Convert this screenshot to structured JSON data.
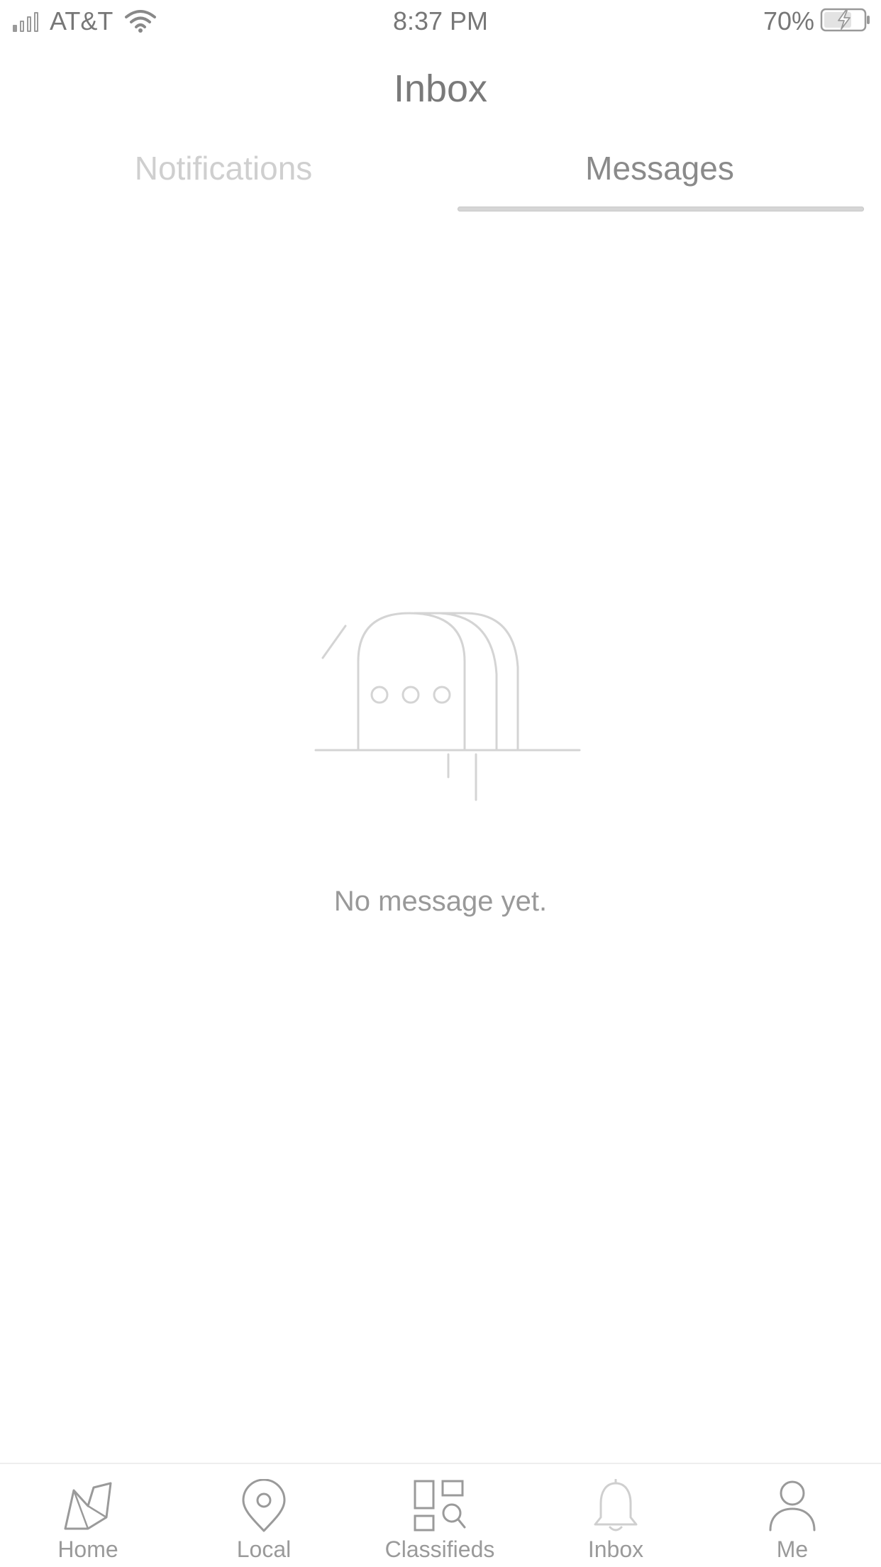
{
  "status_bar": {
    "carrier": "AT&T",
    "time": "8:37 PM",
    "battery": "70%",
    "battery_level": 0.7,
    "signal_bars": 1,
    "icons": [
      "signal-icon",
      "wifi-icon",
      "battery-charging-icon"
    ]
  },
  "header": {
    "title": "Inbox"
  },
  "tabs": [
    {
      "label": "Notifications",
      "active": false
    },
    {
      "label": "Messages",
      "active": true
    }
  ],
  "empty_state": {
    "icon": "mailbox-icon",
    "message": "No message yet."
  },
  "bottom_nav": {
    "items": [
      {
        "label": "Home",
        "icon": "map-icon"
      },
      {
        "label": "Local",
        "icon": "location-pin-icon"
      },
      {
        "label": "Classifieds",
        "icon": "classifieds-search-icon"
      },
      {
        "label": "Inbox",
        "icon": "bell-icon"
      },
      {
        "label": "Me",
        "icon": "person-icon"
      }
    ]
  },
  "colors": {
    "text_primary": "#7a7a7a",
    "text_muted": "#cfcfcf",
    "icon_stroke": "#c8c8c8",
    "background": "#ffffff"
  }
}
